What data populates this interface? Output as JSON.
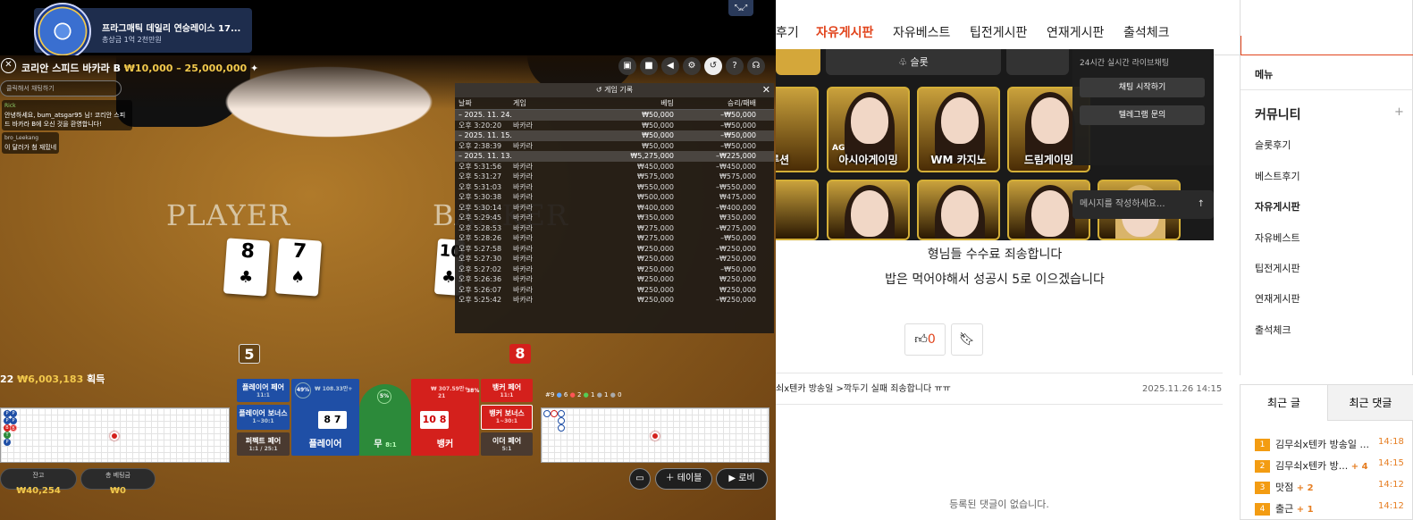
{
  "game": {
    "promo": {
      "title": "프라그매틱 데일리 연승레이스 17...",
      "prize": "총상금 1억 2천만원"
    },
    "title": "코리안 스피드 바카라 B",
    "limits": "₩10,000 – 25,000,000",
    "chat_placeholder": "클릭해서 채팅하기",
    "chat_messages": [
      {
        "name": "Rick",
        "text": "안녕하세요, bum_atsgar95 님! 코리안 스피드 바카라 B에 오신 것을 환영합니다!"
      },
      {
        "name": "bro_Leekang",
        "text": "이 달러가 첨 재밌네"
      }
    ],
    "player_label": "PLAYER",
    "banker_label": "BANKER",
    "player_cards": [
      {
        "rank": "8",
        "suit": "♣"
      },
      {
        "rank": "7",
        "suit": "♠"
      }
    ],
    "banker_card": {
      "rank": "10",
      "suit": "♣"
    },
    "player_score": "5",
    "banker_score": "8",
    "win_count": "22",
    "win_amount": "₩6,003,183",
    "win_suffix": "획득",
    "history": {
      "title": "게임 기록",
      "columns": [
        "날짜",
        "게임",
        "베팅",
        "승리/패배"
      ],
      "rows": [
        {
          "date": "– 2025. 11. 24.",
          "game": "",
          "bet": "₩50,000",
          "result": "–₩50,000",
          "is_date": true
        },
        {
          "date": "오후 3:20:20",
          "game": "바카라",
          "bet": "₩50,000",
          "result": "–₩50,000",
          "is_date": false
        },
        {
          "date": "– 2025. 11. 15.",
          "game": "",
          "bet": "₩50,000",
          "result": "–₩50,000",
          "is_date": true
        },
        {
          "date": "오후 2:38:39",
          "game": "바카라",
          "bet": "₩50,000",
          "result": "–₩50,000",
          "is_date": false
        },
        {
          "date": "– 2025. 11. 13.",
          "game": "",
          "bet": "₩5,275,000",
          "result": "–₩225,000",
          "is_date": true
        },
        {
          "date": "오후 5:31:56",
          "game": "바카라",
          "bet": "₩450,000",
          "result": "–₩450,000",
          "is_date": false
        },
        {
          "date": "오후 5:31:27",
          "game": "바카라",
          "bet": "₩575,000",
          "result": "₩575,000",
          "is_date": false
        },
        {
          "date": "오후 5:31:03",
          "game": "바카라",
          "bet": "₩550,000",
          "result": "–₩550,000",
          "is_date": false
        },
        {
          "date": "오후 5:30:38",
          "game": "바카라",
          "bet": "₩500,000",
          "result": "₩475,000",
          "is_date": false
        },
        {
          "date": "오후 5:30:14",
          "game": "바카라",
          "bet": "₩400,000",
          "result": "–₩400,000",
          "is_date": false
        },
        {
          "date": "오후 5:29:45",
          "game": "바카라",
          "bet": "₩350,000",
          "result": "₩350,000",
          "is_date": false
        },
        {
          "date": "오후 5:28:53",
          "game": "바카라",
          "bet": "₩275,000",
          "result": "–₩275,000",
          "is_date": false
        },
        {
          "date": "오후 5:28:26",
          "game": "바카라",
          "bet": "₩275,000",
          "result": "–₩50,000",
          "is_date": false
        },
        {
          "date": "오후 5:27:58",
          "game": "바카라",
          "bet": "₩250,000",
          "result": "–₩250,000",
          "is_date": false
        },
        {
          "date": "오후 5:27:30",
          "game": "바카라",
          "bet": "₩250,000",
          "result": "–₩250,000",
          "is_date": false
        },
        {
          "date": "오후 5:27:02",
          "game": "바카라",
          "bet": "₩250,000",
          "result": "–₩50,000",
          "is_date": false
        },
        {
          "date": "오후 5:26:36",
          "game": "바카라",
          "bet": "₩250,000",
          "result": "₩250,000",
          "is_date": false
        },
        {
          "date": "오후 5:26:07",
          "game": "바카라",
          "bet": "₩250,000",
          "result": "₩250,000",
          "is_date": false
        },
        {
          "date": "오후 5:25:42",
          "game": "바카라",
          "bet": "₩250,000",
          "result": "–₩250,000",
          "is_date": false
        }
      ]
    },
    "bets": {
      "player_pair": "플레이어 페어",
      "player_pair_odds": "11:1",
      "player_bonus": "플레이어 보너스",
      "player_bonus_odds": "1~30:1",
      "perfect_pair": "퍼펙트 페어",
      "perfect_pair_odds": "1:1 / 25:1",
      "player": "플레이어",
      "player_pct": "49%",
      "player_pool": "₩ 108.33만+",
      "tie": "무",
      "tie_odds": "8:1",
      "tie_pct": "5%",
      "banker": "뱅커",
      "banker_pool": "₩ 307.59만+",
      "banker_pct": "38%",
      "banker_count": "21",
      "banker_pair": "뱅커 페어",
      "banker_pair_odds": "11:1",
      "banker_bonus": "뱅커 보너스",
      "banker_bonus_odds": "1~30:1",
      "either_pair": "이더 페어",
      "either_pair_odds": "5:1"
    },
    "stats": {
      "count": "#9",
      "p": "6",
      "b": "2",
      "t": "1",
      "pp": "1",
      "bp": "0"
    },
    "balance_label": "잔고",
    "balance": "₩40,254",
    "total_bet_label": "총 베팅금",
    "total_bet": "₩0",
    "table_btn": "테이블",
    "lobby_btn": "로비"
  },
  "web": {
    "nav": [
      "후기",
      "자유게시판",
      "자유베스트",
      "팁전게시판",
      "연재게시판",
      "출석체크"
    ],
    "active_nav": "자유게시판",
    "banner_tabs": [
      "슬롯"
    ],
    "chat_panel": {
      "subtitle": "24시간 실시간 라이브채팅",
      "start": "채팅 시작하기",
      "telegram": "텔레그램 문의",
      "placeholder": "메시지를 작성하세요..."
    },
    "tiles": [
      "루션",
      "아시아게이밍",
      "WM 카지노",
      "드림게이밍"
    ],
    "tile_logo": "AG",
    "post_line1": "형님들 수수료 죄송합니다",
    "post_line2": "밥은 먹어야해서 성공시 5로 이으겠습니다",
    "like_count": "0",
    "prev_post": "쇠x텐카 방송일 >깍두기 실패 죄송합니다 ㅠㅠ",
    "prev_date": "2025.11.26 14:15",
    "no_comments": "등록된 댓글이 없습니다.",
    "sidebar": {
      "menu": "메뉴",
      "community": "커뮤니티",
      "items": [
        "슬롯후기",
        "베스트후기",
        "자유게시판",
        "자유베스트",
        "팁전게시판",
        "연재게시판",
        "출석체크"
      ],
      "active": "자유게시판"
    },
    "recent": {
      "tab_posts": "최근 글",
      "tab_comments": "최근 댓글",
      "items": [
        {
          "num": "1",
          "title": "김무쇠x텐카 방송일 ...",
          "count": "",
          "time": "14:18"
        },
        {
          "num": "2",
          "title": "김무쇠x텐카 방...",
          "count": "+ 4",
          "time": "14:15"
        },
        {
          "num": "3",
          "title": "맛점",
          "count": "+ 2",
          "time": "14:12"
        },
        {
          "num": "4",
          "title": "출근",
          "count": "+ 1",
          "time": "14:12"
        }
      ]
    },
    "colors": {
      "accent": "#e1441c",
      "badge": "#f39c12"
    }
  }
}
